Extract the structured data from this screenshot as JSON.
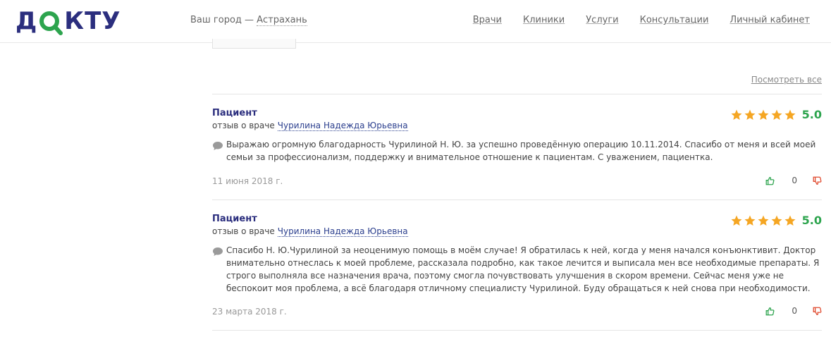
{
  "header": {
    "logo_text": "ДОКТУ",
    "city_prefix": "Ваш город — ",
    "city_name": "Астрахань",
    "nav": [
      "Врачи",
      "Клиники",
      "Услуги",
      "Консультации",
      "Личный кабинет"
    ]
  },
  "reviews_section": {
    "see_all": "Посмотреть все",
    "reviews": [
      {
        "author": "Пациент",
        "about_prefix": "отзыв о враче",
        "doctor": "Чурилина Надежда Юрьевна",
        "rating": "5.0",
        "text": "Выражаю огромную благодарность Чурилиной Н. Ю. за успешно проведённую операцию 10.11.2014. Спасибо от меня и всей моей семьи за профессионализм, поддержку и внимательное отношение к пациентам. С уважением, пациентка.",
        "date": "11 июня 2018 г.",
        "votes": "0"
      },
      {
        "author": "Пациент",
        "about_prefix": "отзыв о враче",
        "doctor": "Чурилина Надежда Юрьевна",
        "rating": "5.0",
        "text": "Спасибо Н. Ю.Чурилиной за неоценимую помощь в моём случае! Я обратилась к ней, когда у меня начался конъюнктивит. Доктор внимательно отнеслась к моей проблеме, рассказала подробно, как такое лечится и выписала мен все необходимые препараты. Я строго выполняла все назначения врача, поэтому смогла почувствовать улучшения в скором времени. Сейчас меня уже не беспокоит моя проблема, а всё благодаря отличному специалисту Чурилиной. Буду обращаться к ней снова при необходимости.",
        "date": "23 марта 2018 г.",
        "votes": "0"
      }
    ]
  },
  "colors": {
    "brand": "#2b2e7e",
    "accent_green": "#2da44e",
    "star": "#f5a623",
    "dislike": "#e04a2f"
  }
}
